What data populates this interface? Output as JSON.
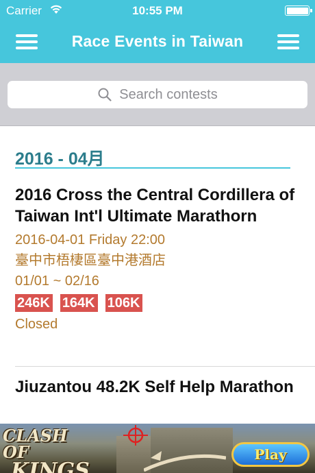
{
  "status_bar": {
    "carrier": "Carrier",
    "wifi_icon": "wifi-icon",
    "time": "10:55 PM",
    "battery_icon": "battery-full-icon",
    "battery_level": 1.0
  },
  "nav": {
    "title": "Race Events in Taiwan",
    "left_icon": "menu-icon",
    "right_icon": "menu-icon"
  },
  "search": {
    "placeholder": "Search contests",
    "icon": "search-icon"
  },
  "sections": [
    {
      "header": "2016 - 04月",
      "events": [
        {
          "title": "2016 Cross the Central Cordillera of Taiwan Int'l Ultimate Marathorn",
          "datetime": "2016-04-01 Friday 22:00",
          "location": "臺中市梧棲區臺中港酒店",
          "registration": "01/01 ~ 02/16",
          "distances": [
            "246K",
            "164K",
            "106K"
          ],
          "status": "Closed"
        },
        {
          "title": "Jiuzantou 48.2K Self Help Marathon"
        }
      ]
    }
  ],
  "ad": {
    "logo_line1": "CLASH OF",
    "logo_line2": "KINGS",
    "play_label": "Play"
  },
  "colors": {
    "accent": "#46c6dc",
    "section_header": "#2c7d8c",
    "meta_text": "#b37a2e",
    "tag_bg": "#d9534f"
  }
}
